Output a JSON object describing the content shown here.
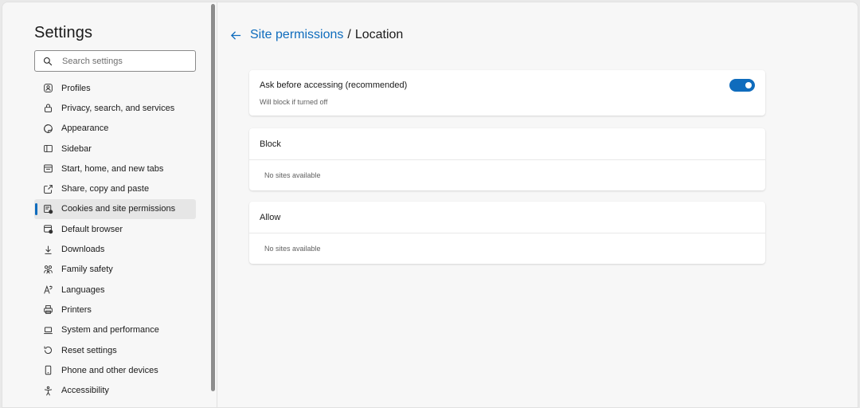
{
  "sidebar": {
    "title": "Settings",
    "search_placeholder": "Search settings",
    "items": [
      {
        "label": "Profiles",
        "icon": "profile-icon"
      },
      {
        "label": "Privacy, search, and services",
        "icon": "lock-icon"
      },
      {
        "label": "Appearance",
        "icon": "appearance-icon"
      },
      {
        "label": "Sidebar",
        "icon": "sidebar-icon"
      },
      {
        "label": "Start, home, and new tabs",
        "icon": "home-tabs-icon"
      },
      {
        "label": "Share, copy and paste",
        "icon": "share-icon"
      },
      {
        "label": "Cookies and site permissions",
        "icon": "cookies-icon",
        "active": true
      },
      {
        "label": "Default browser",
        "icon": "browser-icon"
      },
      {
        "label": "Downloads",
        "icon": "download-icon"
      },
      {
        "label": "Family safety",
        "icon": "family-icon"
      },
      {
        "label": "Languages",
        "icon": "language-icon"
      },
      {
        "label": "Printers",
        "icon": "printer-icon"
      },
      {
        "label": "System and performance",
        "icon": "laptop-icon"
      },
      {
        "label": "Reset settings",
        "icon": "reset-icon"
      },
      {
        "label": "Phone and other devices",
        "icon": "phone-icon"
      },
      {
        "label": "Accessibility",
        "icon": "accessibility-icon"
      }
    ]
  },
  "header": {
    "breadcrumb_link": "Site permissions",
    "separator": "/",
    "current": "Location"
  },
  "ask_card": {
    "label": "Ask before accessing (recommended)",
    "sublabel": "Will block if turned off",
    "toggle_on": true
  },
  "block_card": {
    "title": "Block",
    "empty": "No sites available"
  },
  "allow_card": {
    "title": "Allow",
    "empty": "No sites available"
  },
  "colors": {
    "accent": "#0f6cbd",
    "background": "#f7f7f7"
  }
}
